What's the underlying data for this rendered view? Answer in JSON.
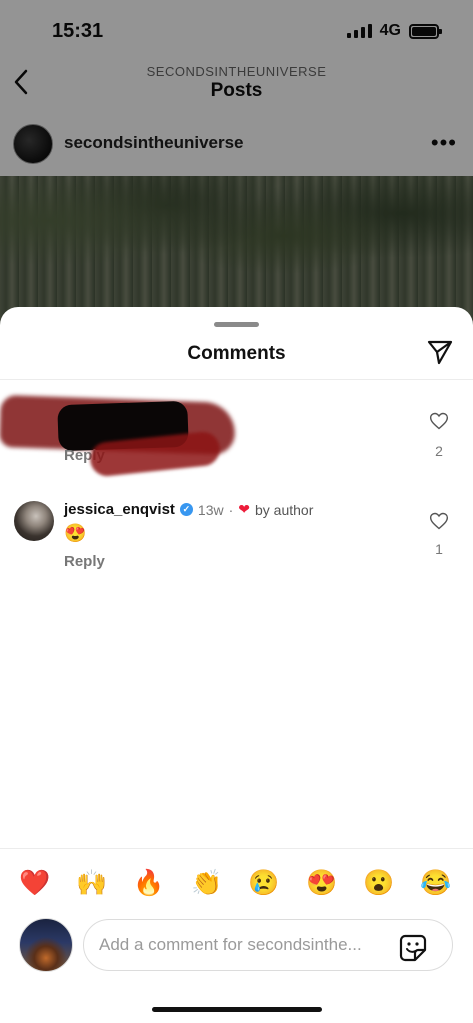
{
  "status_bar": {
    "time": "15:31",
    "network": "4G"
  },
  "nav": {
    "subtitle": "SECONDSINTHEUNIVERSE",
    "title": "Posts"
  },
  "post": {
    "username": "secondsintheuniverse",
    "more_label": "•••"
  },
  "sheet": {
    "title": "Comments",
    "comments": [
      {
        "username": "",
        "text": "",
        "reply_label": "Reply",
        "like_count": "2",
        "redacted": true
      },
      {
        "username": "jessica_enqvist",
        "verified": true,
        "time": "13w",
        "separator": "·",
        "author_like_label": "by author",
        "text": "😍",
        "reply_label": "Reply",
        "like_count": "1"
      }
    ]
  },
  "quick_reactions": [
    "❤️",
    "🙌",
    "🔥",
    "👏",
    "😢",
    "😍",
    "😮",
    "😂"
  ],
  "composer": {
    "placeholder": "Add a comment for secondsinthe...",
    "value": ""
  },
  "colors": {
    "verified": "#3897f0",
    "like_heart": "#ed1c3a"
  }
}
